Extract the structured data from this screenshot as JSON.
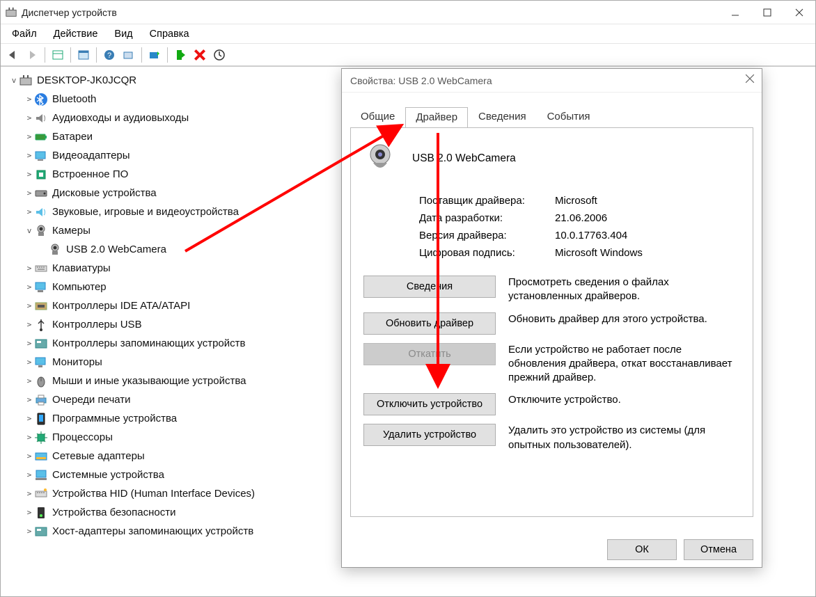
{
  "window": {
    "title": "Диспетчер устройств"
  },
  "menu": {
    "file": "Файл",
    "action": "Действие",
    "view": "Вид",
    "help": "Справка"
  },
  "tree": {
    "root": "DESKTOP-JK0JCQR",
    "bluetooth": "Bluetooth",
    "audio": "Аудиовходы и аудиовыходы",
    "batteries": "Батареи",
    "video": "Видеоадаптеры",
    "firmware": "Встроенное ПО",
    "disks": "Дисковые устройства",
    "sound": "Звуковые, игровые и видеоустройства",
    "cameras": "Камеры",
    "camera_item": "USB 2.0 WebCamera",
    "keyboards": "Клавиатуры",
    "computer": "Компьютер",
    "ide": "Контроллеры IDE ATA/ATAPI",
    "usb": "Контроллеры USB",
    "storage": "Контроллеры запоминающих устройств",
    "monitors": "Мониторы",
    "mice": "Мыши и иные указывающие устройства",
    "print": "Очереди печати",
    "software": "Программные устройства",
    "cpu": "Процессоры",
    "network": "Сетевые адаптеры",
    "system": "Системные устройства",
    "hid": "Устройства HID (Human Interface Devices)",
    "security": "Устройства безопасности",
    "host": "Хост-адаптеры запоминающих устройств"
  },
  "prop": {
    "title": "Свойства: USB 2.0 WebCamera",
    "tabs": {
      "general": "Общие",
      "driver": "Драйвер",
      "details": "Сведения",
      "events": "События"
    },
    "dev_name": "USB 2.0 WebCamera",
    "labels": {
      "provider": "Поставщик драйвера:",
      "date": "Дата разработки:",
      "version": "Версия драйвера:",
      "signer": "Цифровая подпись:"
    },
    "values": {
      "provider": "Microsoft",
      "date": "21.06.2006",
      "version": "10.0.17763.404",
      "signer": "Microsoft Windows"
    },
    "buttons": {
      "info": "Сведения",
      "update": "Обновить драйвер",
      "rollback": "Откатить",
      "disable": "Отключить устройство",
      "uninstall": "Удалить устройство",
      "ok": "ОК",
      "cancel": "Отмена"
    },
    "desc": {
      "info": "Просмотреть сведения о файлах установленных драйверов.",
      "update": "Обновить драйвер для этого устройства.",
      "rollback": "Если устройство не работает после обновления драйвера, откат восстанавливает прежний драйвер.",
      "disable": "Отключите устройство.",
      "uninstall": "Удалить это устройство из системы (для опытных пользователей)."
    }
  }
}
